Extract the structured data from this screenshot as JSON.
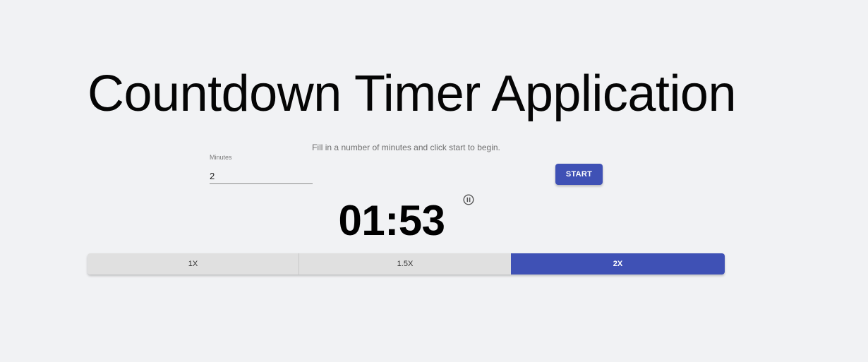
{
  "header": {
    "title": "Countdown Timer Application"
  },
  "instructions": "Fill in a number of minutes and click start to begin.",
  "minutes_field": {
    "label": "Minutes",
    "value": "2"
  },
  "start_button": {
    "label": "START"
  },
  "timer": {
    "display": "01:53",
    "pause_icon": "pause-circle-icon"
  },
  "speed_options": [
    {
      "label": "1X",
      "selected": false
    },
    {
      "label": "1.5X",
      "selected": false
    },
    {
      "label": "2X",
      "selected": true
    }
  ],
  "colors": {
    "background": "#f1f2f4",
    "accent": "#3f51b5",
    "button_default": "#e0e0e0"
  }
}
